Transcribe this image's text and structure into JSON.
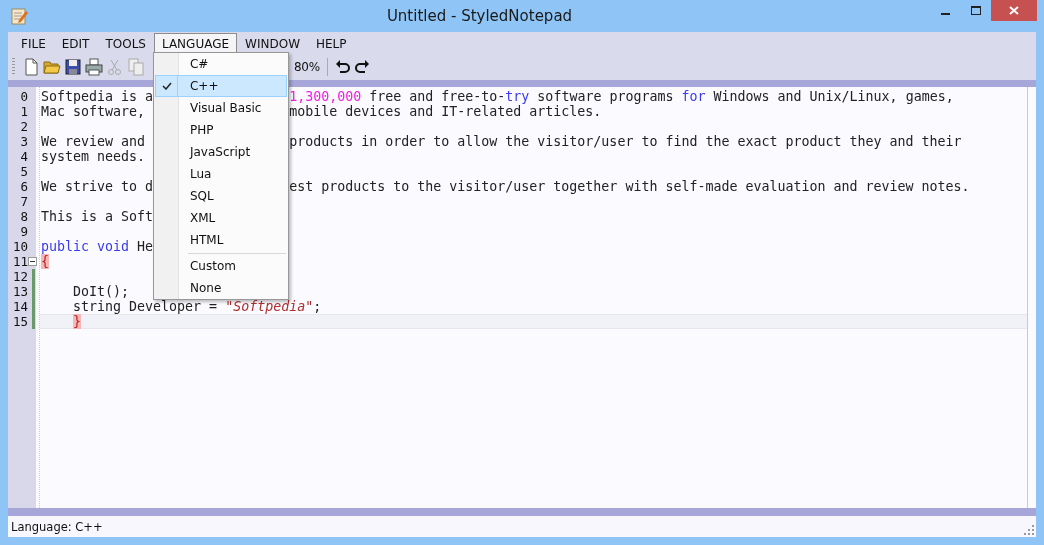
{
  "window": {
    "title": "Untitled - StyledNotepad"
  },
  "menubar": [
    {
      "label": "FILE",
      "open": false
    },
    {
      "label": "EDIT",
      "open": false
    },
    {
      "label": "TOOLS",
      "open": false
    },
    {
      "label": "LANGUAGE",
      "open": true
    },
    {
      "label": "WINDOW",
      "open": false
    },
    {
      "label": "HELP",
      "open": false
    }
  ],
  "language_menu": [
    {
      "kind": "item",
      "label": "C#",
      "checked": false,
      "highlighted": false
    },
    {
      "kind": "item",
      "label": "C++",
      "checked": true,
      "highlighted": true
    },
    {
      "kind": "item",
      "label": "Visual Basic",
      "checked": false,
      "highlighted": false
    },
    {
      "kind": "item",
      "label": "PHP",
      "checked": false,
      "highlighted": false
    },
    {
      "kind": "item",
      "label": "JavaScript",
      "checked": false,
      "highlighted": false
    },
    {
      "kind": "item",
      "label": "Lua",
      "checked": false,
      "highlighted": false
    },
    {
      "kind": "item",
      "label": "SQL",
      "checked": false,
      "highlighted": false
    },
    {
      "kind": "item",
      "label": "XML",
      "checked": false,
      "highlighted": false
    },
    {
      "kind": "item",
      "label": "HTML",
      "checked": false,
      "highlighted": false
    },
    {
      "kind": "separator"
    },
    {
      "kind": "item",
      "label": "Custom",
      "checked": false,
      "highlighted": false
    },
    {
      "kind": "item",
      "label": "None",
      "checked": false,
      "highlighted": false
    }
  ],
  "toolbar": {
    "zoom": "80%"
  },
  "editor": {
    "lines": [
      {
        "number": "0",
        "fold_marker": false,
        "fold_bar": false,
        "current": false,
        "left": [
          {
            "kind": "text",
            "text": "Softpedia is a"
          }
        ],
        "right": [
          {
            "kind": "number",
            "text": "1,300,000"
          },
          {
            "kind": "text",
            "text": " free and free-to-"
          },
          {
            "kind": "keyword",
            "text": "try"
          },
          {
            "kind": "text",
            "text": " software programs "
          },
          {
            "kind": "keyword",
            "text": "for"
          },
          {
            "kind": "text",
            "text": " Windows and Unix/Linux, games,"
          }
        ]
      },
      {
        "number": "1",
        "fold_marker": false,
        "fold_bar": false,
        "current": false,
        "left": [
          {
            "kind": "text",
            "text": "Mac software,"
          }
        ],
        "right": [
          {
            "kind": "text",
            "text": "mobile devices and IT-related articles."
          }
        ]
      },
      {
        "number": "2",
        "fold_marker": false,
        "fold_bar": false,
        "current": false
      },
      {
        "number": "3",
        "fold_marker": false,
        "fold_bar": false,
        "current": false,
        "left": [
          {
            "kind": "text",
            "text": "We review and"
          }
        ],
        "right": [
          {
            "kind": "text",
            "text": "products in order to allow the visitor/user to find the exact product they and their"
          }
        ]
      },
      {
        "number": "4",
        "fold_marker": false,
        "fold_bar": false,
        "current": false,
        "left": [
          {
            "kind": "text",
            "text": "system needs."
          }
        ]
      },
      {
        "number": "5",
        "fold_marker": false,
        "fold_bar": false,
        "current": false
      },
      {
        "number": "6",
        "fold_marker": false,
        "fold_bar": false,
        "current": false,
        "left": [
          {
            "kind": "text",
            "text": "We strive to d"
          }
        ],
        "right": [
          {
            "kind": "text",
            "text": "est products to the visitor/user together with self-made evaluation and review notes."
          }
        ]
      },
      {
        "number": "7",
        "fold_marker": false,
        "fold_bar": false,
        "current": false
      },
      {
        "number": "8",
        "fold_marker": false,
        "fold_bar": false,
        "current": false,
        "left": [
          {
            "kind": "text",
            "text": "This is a Soft"
          }
        ]
      },
      {
        "number": "9",
        "fold_marker": false,
        "fold_bar": false,
        "current": false
      },
      {
        "number": "10",
        "fold_marker": false,
        "fold_bar": false,
        "current": false,
        "left": [
          {
            "kind": "keyword",
            "text": "public void"
          },
          {
            "kind": "text",
            "text": " He"
          }
        ]
      },
      {
        "number": "11",
        "fold_marker": true,
        "fold_bar": false,
        "current": false,
        "left": [
          {
            "kind": "brace",
            "text": "{"
          }
        ]
      },
      {
        "number": "12",
        "fold_marker": false,
        "fold_bar": true,
        "current": false
      },
      {
        "number": "13",
        "fold_marker": false,
        "fold_bar": true,
        "current": false,
        "left": [
          {
            "kind": "text",
            "text": "    DoIt();"
          }
        ]
      },
      {
        "number": "14",
        "fold_marker": false,
        "fold_bar": true,
        "current": false,
        "left": [
          {
            "kind": "text",
            "text": "    string Developer = "
          },
          {
            "kind": "string",
            "text": "\"Softpedia\""
          },
          {
            "kind": "text",
            "text": ";"
          }
        ]
      },
      {
        "number": "15",
        "fold_marker": false,
        "fold_bar": true,
        "current": true,
        "indented": true,
        "left": [
          {
            "kind": "brace",
            "text": "}"
          }
        ]
      }
    ]
  },
  "status_bar": {
    "text": "Language: C++"
  }
}
